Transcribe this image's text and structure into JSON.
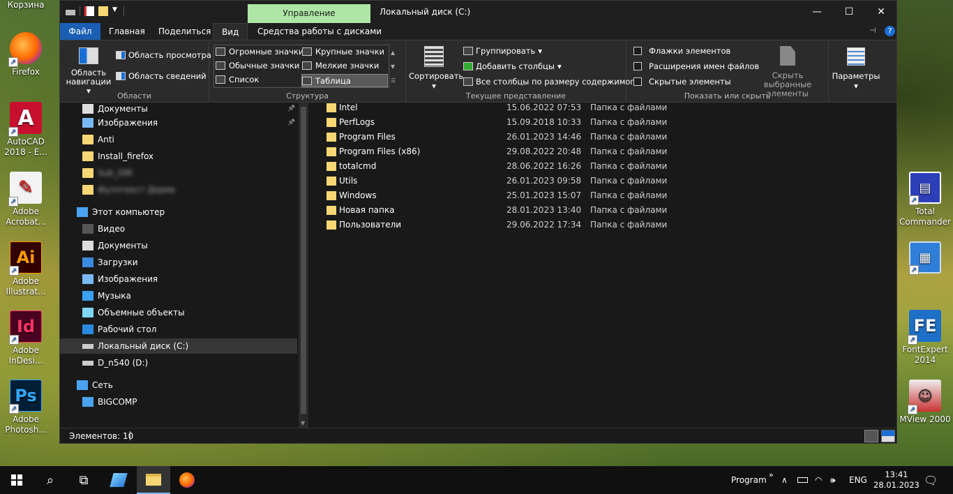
{
  "desktop": {
    "top_label_partial": "Корзина",
    "icons_left": [
      {
        "label": "Firefox",
        "icon": "firefox-icon",
        "color": "#e66000"
      },
      {
        "label": "AutoCAD 2018 - E...",
        "icon": "autocad-icon",
        "color": "#c8102e"
      },
      {
        "label": "Adobe Acrobat...",
        "icon": "acrobat-icon",
        "color": "#ffffff"
      },
      {
        "label": "Adobe Illustrat...",
        "icon": "illustrator-icon",
        "color": "#330000"
      },
      {
        "label": "Adobe InDesi...",
        "icon": "indesign-icon",
        "color": "#49021f"
      },
      {
        "label": "Adobe Photosh...",
        "icon": "photoshop-icon",
        "color": "#001e36"
      }
    ],
    "icons_right": [
      {
        "label": "Total Commander",
        "icon": "total-commander-icon"
      },
      {
        "label": "",
        "icon": "presentation-icon"
      },
      {
        "label": "FontExpert 2014",
        "icon": "fontexpert-icon"
      },
      {
        "label": "MView 2000",
        "icon": "mview-icon"
      }
    ],
    "icon_letters": {
      "autocad": "A",
      "illustrator": "Ai",
      "indesign": "Id",
      "photoshop": "Ps",
      "fontexpert": "FE"
    }
  },
  "window": {
    "title": "Локальный диск (C:)",
    "context_tab": "Управление",
    "controls": {
      "minimize": "—",
      "maximize": "☐",
      "close": "✕"
    },
    "menu": {
      "file": "Файл",
      "home": "Главная",
      "share": "Поделиться",
      "view": "Вид",
      "disk_tools": "Средства работы с дисками"
    },
    "ribbon": {
      "panes": {
        "nav_pane": "Область навигации",
        "preview": "Область просмотра",
        "details": "Область сведений",
        "label": "Области"
      },
      "layout": {
        "items": [
          "Огромные значки",
          "Крупные значки",
          "Обычные значки",
          "Мелкие значки",
          "Список",
          "Таблица"
        ],
        "selected": "Таблица",
        "label": "Структура"
      },
      "current_view": {
        "sort": "Сортировать",
        "group": "Группировать",
        "add_columns": "Добавить столбцы",
        "fit_columns": "Все столбцы по размеру содержимого",
        "label": "Текущее представление"
      },
      "show_hide": {
        "checkboxes": "Флажки элементов",
        "extensions": "Расширения имен файлов",
        "hidden": "Скрытые элементы",
        "hide_selected": "Скрыть выбранные элементы",
        "label": "Показать или скрыть"
      },
      "options": "Параметры"
    },
    "nav_items": [
      {
        "label": "Документы",
        "type": "docs",
        "indent": 1,
        "pinned": true
      },
      {
        "label": "Изображения",
        "type": "pics",
        "indent": 1,
        "pinned": true
      },
      {
        "label": "Anti",
        "type": "folder",
        "indent": 1
      },
      {
        "label": "Install_firefox",
        "type": "folder",
        "indent": 1
      },
      {
        "label": "Sub_DIR",
        "type": "folder",
        "indent": 1,
        "blurred": true
      },
      {
        "label": "Фуллтекст Дерев",
        "type": "folder",
        "indent": 1,
        "blurred": true
      },
      {
        "label": "Этот компьютер",
        "type": "pc",
        "indent": 0
      },
      {
        "label": "Видео",
        "type": "video",
        "indent": 1
      },
      {
        "label": "Документы",
        "type": "docs",
        "indent": 1
      },
      {
        "label": "Загрузки",
        "type": "down",
        "indent": 1
      },
      {
        "label": "Изображения",
        "type": "pics",
        "indent": 1
      },
      {
        "label": "Музыка",
        "type": "music",
        "indent": 1
      },
      {
        "label": "Объемные объекты",
        "type": "3d",
        "indent": 1
      },
      {
        "label": "Рабочий стол",
        "type": "desk",
        "indent": 1
      },
      {
        "label": "Локальный диск (C:)",
        "type": "drive",
        "indent": 1,
        "selected": true
      },
      {
        "label": "D_n540 (D:)",
        "type": "drive",
        "indent": 1
      },
      {
        "label": "Сеть",
        "type": "net",
        "indent": 0
      },
      {
        "label": "BIGCOMP",
        "type": "pc",
        "indent": 1
      }
    ],
    "files": [
      {
        "name": "Intel",
        "date": "15.06.2022 07:53",
        "type": "Папка с файлами"
      },
      {
        "name": "PerfLogs",
        "date": "15.09.2018 10:33",
        "type": "Папка с файлами"
      },
      {
        "name": "Program Files",
        "date": "26.01.2023 14:46",
        "type": "Папка с файлами"
      },
      {
        "name": "Program Files (x86)",
        "date": "29.08.2022 20:48",
        "type": "Папка с файлами"
      },
      {
        "name": "totalcmd",
        "date": "28.06.2022 16:26",
        "type": "Папка с файлами"
      },
      {
        "name": "Utils",
        "date": "26.01.2023 09:58",
        "type": "Папка с файлами"
      },
      {
        "name": "Windows",
        "date": "25.01.2023 15:07",
        "type": "Папка с файлами"
      },
      {
        "name": "Новая папка",
        "date": "28.01.2023 13:40",
        "type": "Папка с файлами"
      },
      {
        "name": "Пользователи",
        "date": "29.06.2022 17:34",
        "type": "Папка с файлами"
      }
    ],
    "status": "Элементов: 10"
  },
  "taskbar": {
    "program": "Program",
    "lang": "ENG",
    "time": "13:41",
    "date": "28.01.2023",
    "chevron": "»"
  },
  "colors": {
    "accent": "#1a5fb4",
    "context_tab": "#aee6a6",
    "folder": "#f7d774"
  }
}
